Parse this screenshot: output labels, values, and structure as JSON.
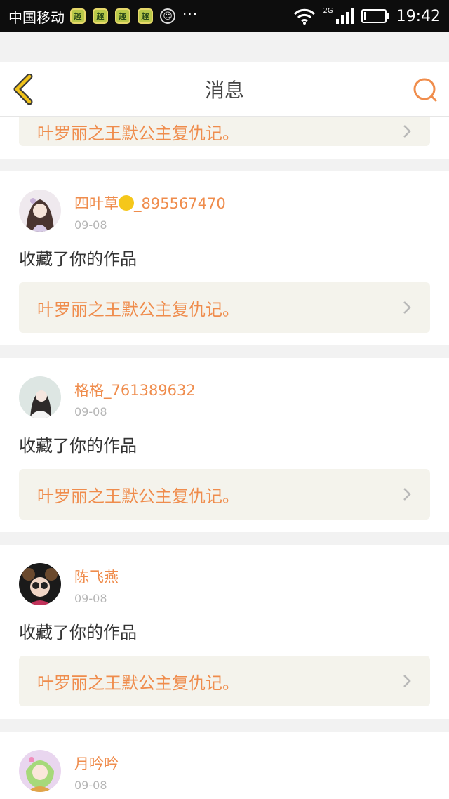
{
  "status_bar": {
    "carrier": "中国移动",
    "app_badge_text": "趣",
    "smile_glyph": "☺",
    "dots": "···",
    "network": "2G",
    "time": "19:42"
  },
  "header": {
    "title": "消息"
  },
  "feed": {
    "top_partial_work": "叶罗丽之王默公主复仇记。",
    "cards": [
      {
        "username_prefix": "四叶草",
        "username_suffix": "_895567470",
        "date": "09-08",
        "action": "收藏了你的作品",
        "work": "叶罗丽之王默公主复仇记。"
      },
      {
        "username": "格格_761389632",
        "date": "09-08",
        "action": "收藏了你的作品",
        "work": "叶罗丽之王默公主复仇记。"
      },
      {
        "username": "陈飞燕",
        "date": "09-08",
        "action": "收藏了你的作品",
        "work": "叶罗丽之王默公主复仇记。"
      },
      {
        "username": "月吟吟",
        "date": "09-08"
      }
    ]
  },
  "colors": {
    "accent": "#ef8c4c",
    "link_bg": "#f4f3ec",
    "back_icon": "#f0c21a",
    "page_bg": "#f2f2f2"
  },
  "icons": {
    "back": "chevron-left-icon",
    "search": "search-icon",
    "work_arrow": "chevron-right-icon"
  }
}
